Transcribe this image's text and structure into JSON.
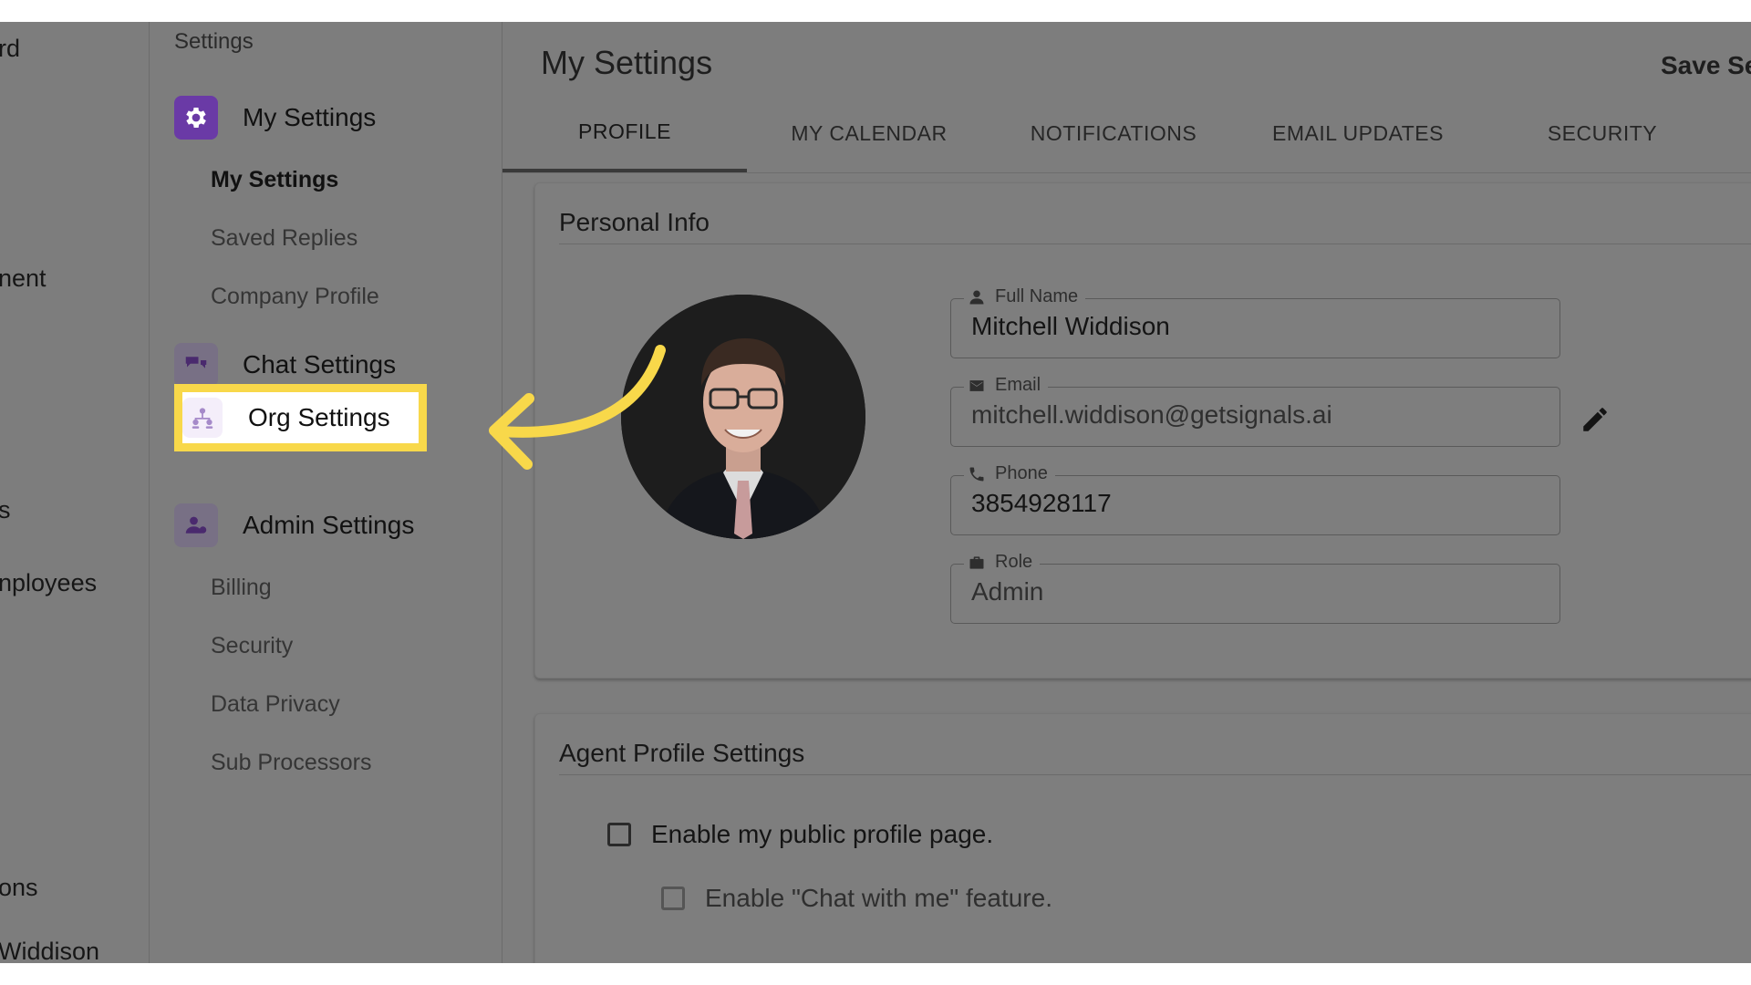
{
  "left_nav": {
    "items": [
      "rd",
      "nent",
      "s",
      "nployees",
      "ons",
      "Widdison"
    ]
  },
  "sidebar": {
    "title": "Settings",
    "groups": {
      "my_settings": "My Settings",
      "chat_settings": "Chat Settings",
      "org_settings": "Org Settings",
      "admin_settings": "Admin Settings"
    },
    "my_settings_items": [
      "My Settings",
      "Saved Replies",
      "Company Profile"
    ],
    "admin_items": [
      "Billing",
      "Security",
      "Data Privacy",
      "Sub Processors"
    ]
  },
  "header": {
    "title": "My Settings",
    "save_label": "Save Se"
  },
  "tabs": [
    "PROFILE",
    "MY CALENDAR",
    "NOTIFICATIONS",
    "EMAIL UPDATES",
    "SECURITY"
  ],
  "active_tab": "PROFILE",
  "personal_info": {
    "title": "Personal Info",
    "fields": [
      {
        "label": "Full Name",
        "value": "Mitchell Widdison",
        "icon": "person-icon"
      },
      {
        "label": "Email",
        "value": "mitchell.widdison@getsignals.ai",
        "icon": "email-icon"
      },
      {
        "label": "Phone",
        "value": "3854928117",
        "icon": "phone-icon"
      },
      {
        "label": "Role",
        "value": "Admin",
        "icon": "briefcase-icon"
      }
    ]
  },
  "agent_profile": {
    "title": "Agent Profile Settings",
    "options": [
      {
        "label": "Enable my public profile page.",
        "checked": false
      },
      {
        "label": "Enable \"Chat with me\" feature.",
        "checked": false
      }
    ]
  },
  "colors": {
    "highlight": "#f8d84a",
    "arrow": "#f8d84a",
    "accent": "#6a3aa6"
  }
}
